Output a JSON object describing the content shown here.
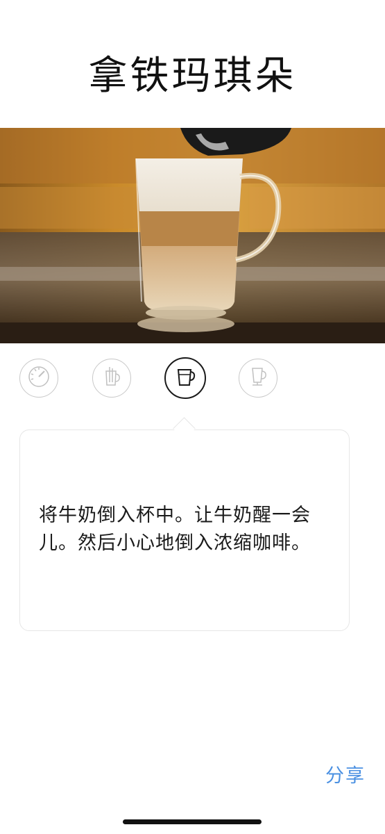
{
  "header": {
    "title": "拿铁玛琪朵"
  },
  "hero": {
    "image_subject": "latte-macchiato-glass"
  },
  "steps": [
    {
      "icon": "gauge-icon",
      "active": false
    },
    {
      "icon": "milk-jug-icon",
      "active": false
    },
    {
      "icon": "milk-pitcher-icon",
      "active": true
    },
    {
      "icon": "latte-glass-icon",
      "active": false
    }
  ],
  "instruction": {
    "text": "将牛奶倒入杯中。让牛奶醒一会儿。然后小心地倒入浓缩咖啡。"
  },
  "footer": {
    "share_label": "分享"
  },
  "colors": {
    "accent": "#4a90e2",
    "active_step": "#1a1a1a",
    "inactive_step": "#c8c8c8"
  }
}
